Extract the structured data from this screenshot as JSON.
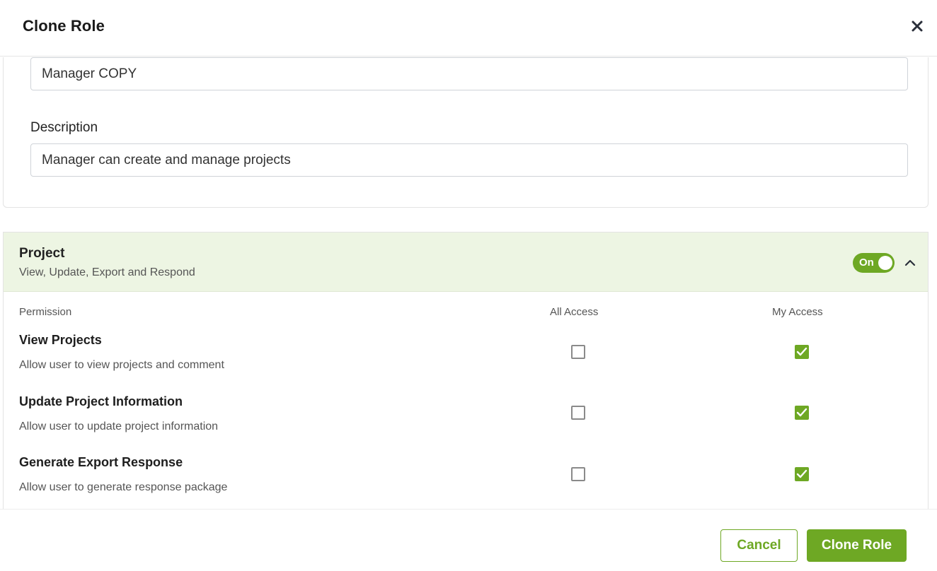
{
  "dialog": {
    "title": "Clone Role"
  },
  "form": {
    "name_value": "Manager COPY",
    "description_label": "Description",
    "description_value": "Manager can create and manage projects"
  },
  "section": {
    "title": "Project",
    "subtitle": "View, Update, Export and Respond",
    "toggle_label": "On",
    "toggle_state": "on",
    "expanded": true,
    "columns": {
      "permission": "Permission",
      "all_access": "All Access",
      "my_access": "My Access"
    },
    "permissions": [
      {
        "name": "View Projects",
        "description": "Allow user to view projects and comment",
        "all_access": false,
        "my_access": true
      },
      {
        "name": "Update Project Information",
        "description": "Allow user to update project information",
        "all_access": false,
        "my_access": true
      },
      {
        "name": "Generate Export Response",
        "description": "Allow user to generate response package",
        "all_access": false,
        "my_access": true
      }
    ]
  },
  "footer": {
    "cancel_label": "Cancel",
    "clone_label": "Clone Role"
  },
  "colors": {
    "accent": "#6ea824",
    "section_bg": "#edf5e3"
  },
  "icons": {
    "close": "close-icon",
    "collapse": "chevron-up-icon",
    "checked": "checkmark-icon"
  }
}
